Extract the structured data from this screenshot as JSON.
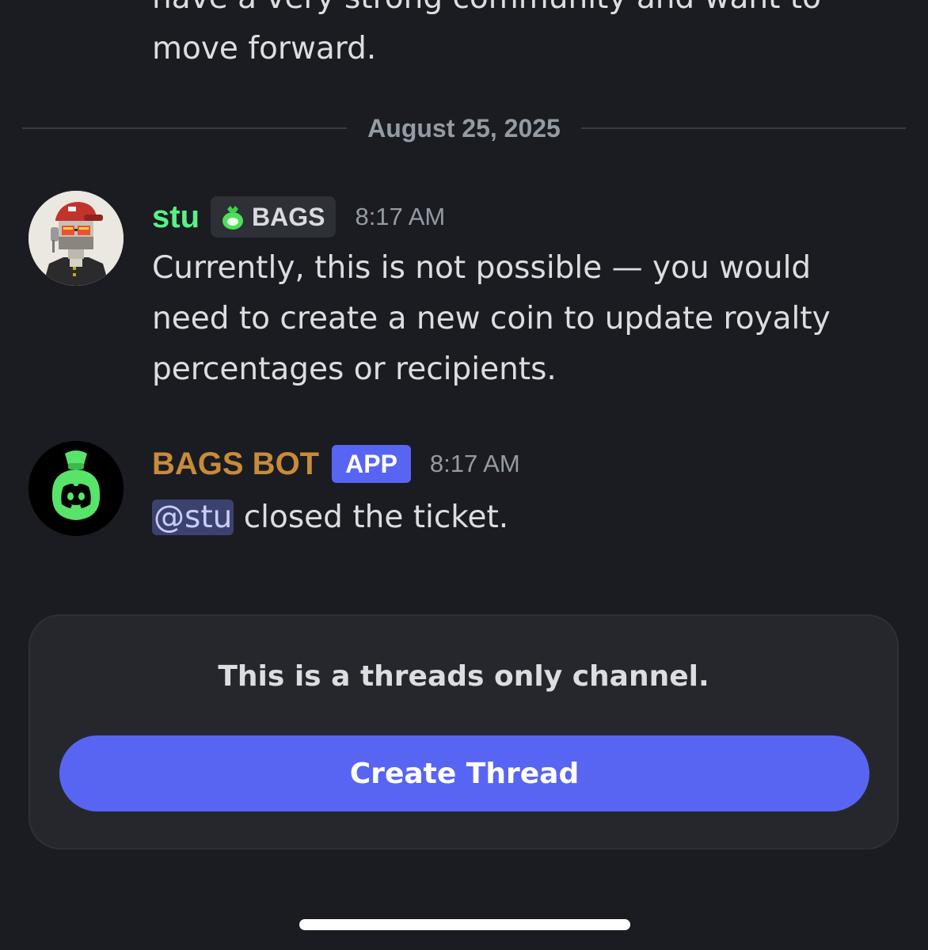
{
  "previous_message": {
    "text": "have a very strong community and want to move forward."
  },
  "date_divider": "August 25, 2025",
  "messages": [
    {
      "author": "stu",
      "author_color": "#57f287",
      "role_tag": "BAGS",
      "time": "8:17 AM",
      "text": "Currently, this is not possible — you would need to create a new coin to update royalty percentages or recipients."
    },
    {
      "author": "BAGS BOT",
      "author_color": "#c88b3a",
      "badge": "APP",
      "time": "8:17 AM",
      "mention": "@stu",
      "text": " closed the ticket."
    }
  ],
  "thread_card": {
    "notice": "This is a threads only channel.",
    "button_label": "Create Thread"
  },
  "icons": {
    "stu_avatar": "pixel-art-character-avatar",
    "bot_avatar": "money-bag-discord-logo-avatar",
    "role_icon": "green-money-bag-icon"
  },
  "colors": {
    "background": "#1b1c21",
    "accent": "#5865f2",
    "card": "#26272d"
  }
}
